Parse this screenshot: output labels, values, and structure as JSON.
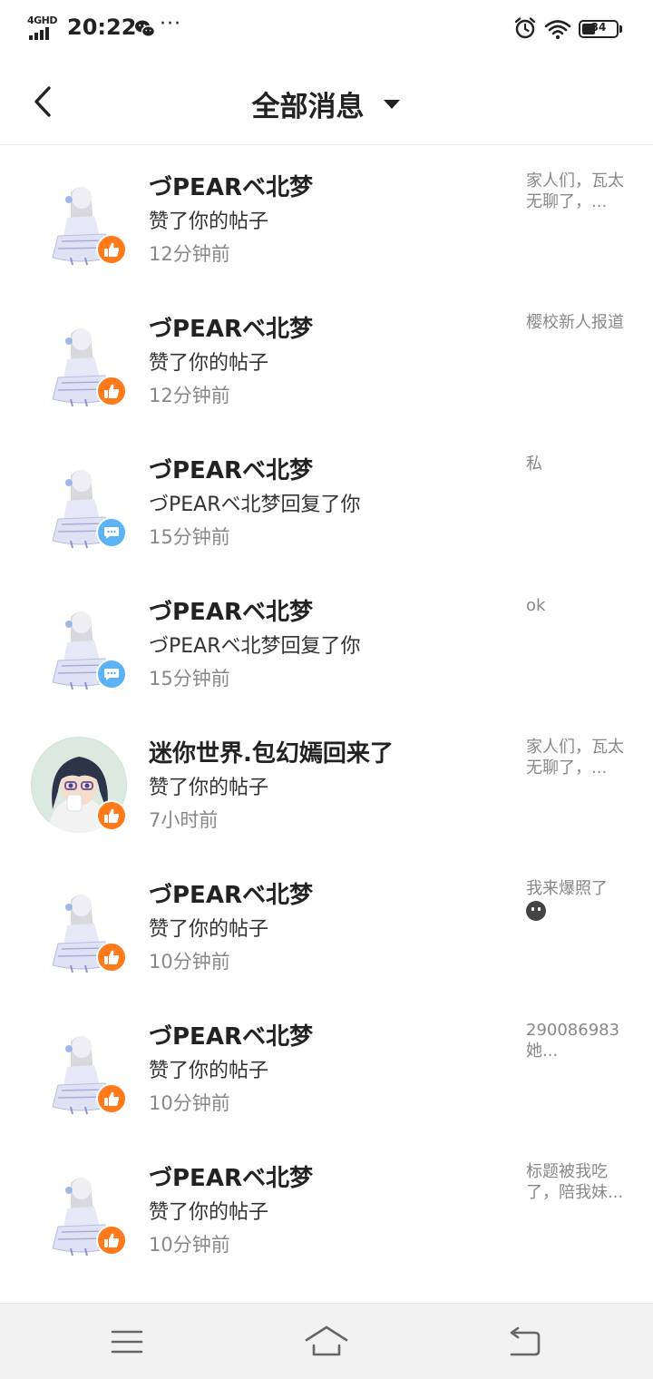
{
  "status_bar": {
    "network": "4GHD",
    "time": "20:22",
    "more": "···",
    "battery": "34"
  },
  "header": {
    "title": "全部消息"
  },
  "messages": [
    {
      "name": "づPEARベ北梦",
      "action": "赞了你的帖子",
      "time": "12分钟前",
      "preview": "家人们，瓦太无聊了，...",
      "type": "like",
      "avatar": "anime-girl-white"
    },
    {
      "name": "づPEARベ北梦",
      "action": "赞了你的帖子",
      "time": "12分钟前",
      "preview": "樱校新人报道",
      "type": "like",
      "avatar": "anime-girl-white"
    },
    {
      "name": "づPEARベ北梦",
      "action": "づPEARベ北梦回复了你",
      "time": "15分钟前",
      "preview": "私",
      "type": "comment",
      "avatar": "anime-girl-white"
    },
    {
      "name": "づPEARベ北梦",
      "action": "づPEARベ北梦回复了你",
      "time": "15分钟前",
      "preview": "ok",
      "type": "comment",
      "avatar": "anime-girl-white"
    },
    {
      "name": "迷你世界.包幻嫣回来了",
      "action": "赞了你的帖子",
      "time": "7小时前",
      "preview": "家人们，瓦太无聊了，...",
      "type": "like",
      "avatar": "anime-girl-dark-hair"
    },
    {
      "name": "づPEARベ北梦",
      "action": "赞了你的帖子",
      "time": "10分钟前",
      "preview": "我来爆照了",
      "preview_emoji": true,
      "type": "like",
      "avatar": "anime-girl-white"
    },
    {
      "name": "づPEARベ北梦",
      "action": "赞了你的帖子",
      "time": "10分钟前",
      "preview": "290086983她...",
      "type": "like",
      "avatar": "anime-girl-white"
    },
    {
      "name": "づPEARベ北梦",
      "action": "赞了你的帖子",
      "time": "10分钟前",
      "preview": "标题被我吃了，陪我妹...",
      "type": "like",
      "avatar": "anime-girl-white"
    }
  ],
  "colors": {
    "like_badge": "#ff7a1a",
    "comment_badge": "#5ab3f5",
    "text_primary": "#222222",
    "text_secondary": "#888888"
  }
}
